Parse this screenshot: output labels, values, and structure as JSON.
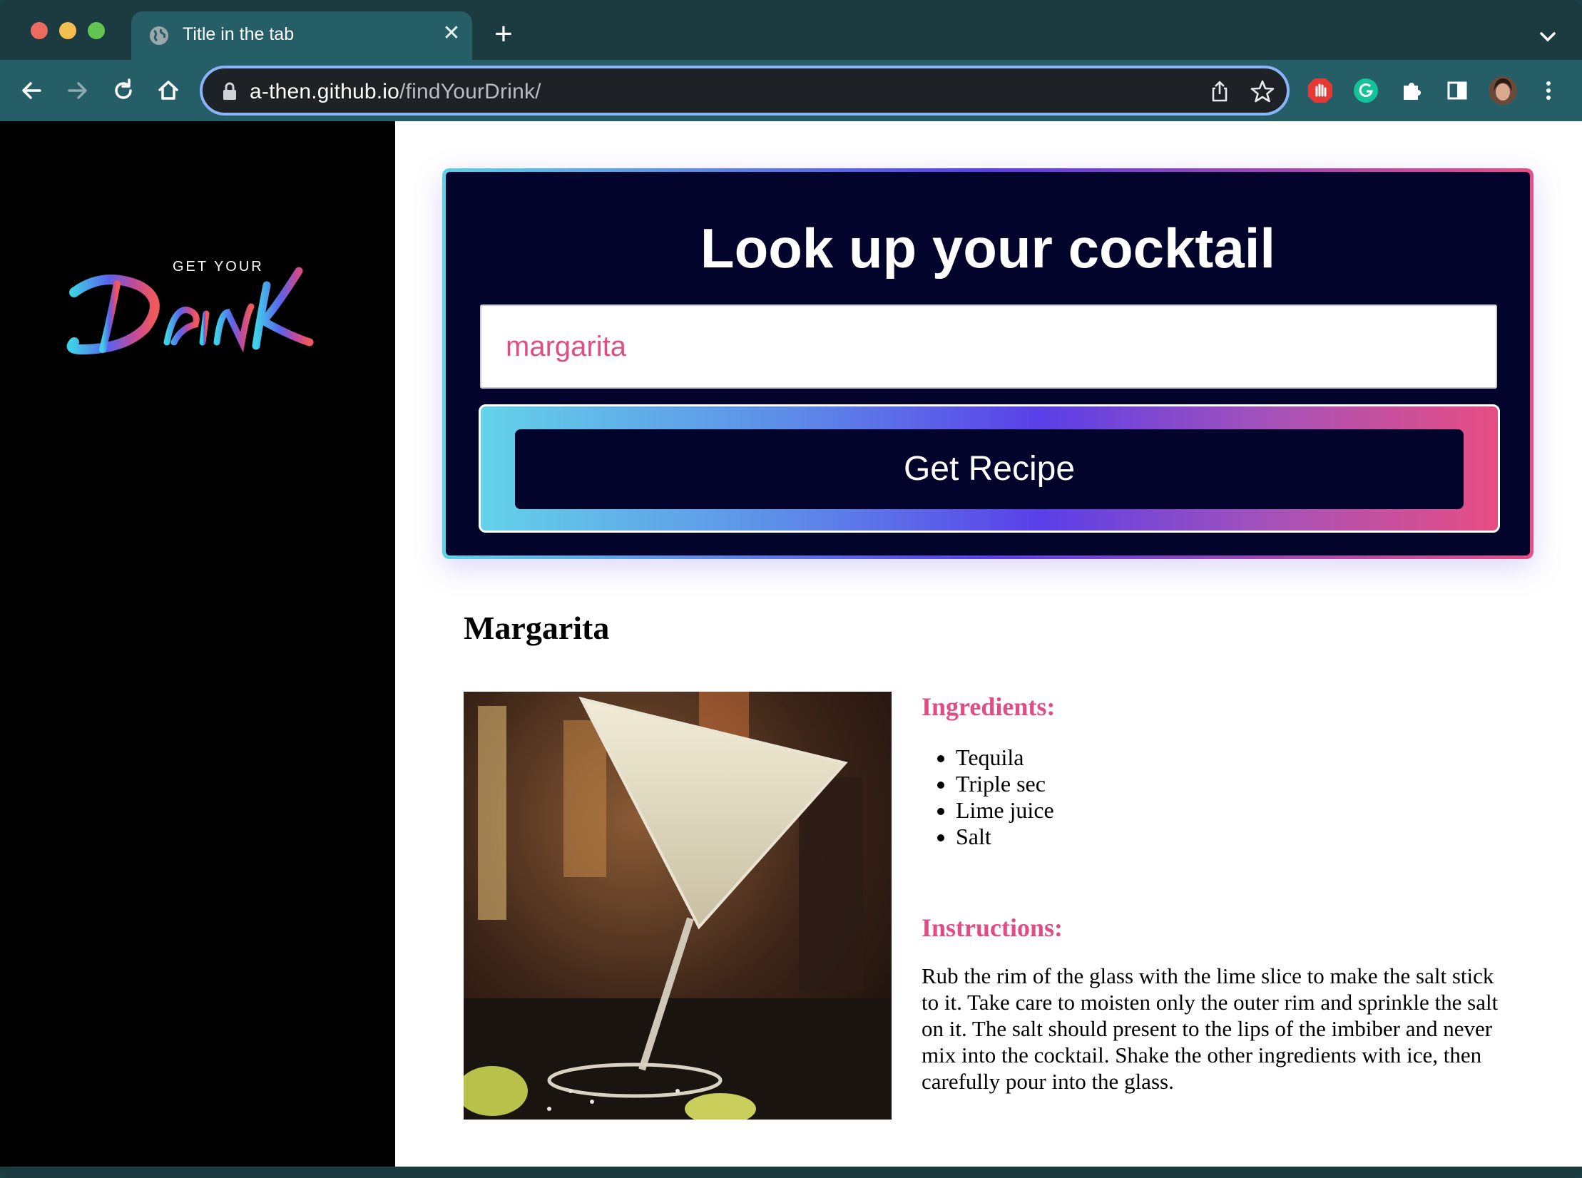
{
  "browser": {
    "tab_title": "Title in the tab",
    "url_host": "a-then.github.io",
    "url_path": "/findYourDrink/"
  },
  "sidebar": {
    "logo_top": "GET YOUR",
    "logo_main": "DRINK"
  },
  "search": {
    "title": "Look up your cocktail",
    "value": "margarita",
    "button_label": "Get Recipe"
  },
  "drink": {
    "name": "Margarita",
    "ingredients_heading": "Ingredients:",
    "ingredients": [
      "Tequila",
      "Triple sec",
      "Lime juice",
      "Salt"
    ],
    "instructions_heading": "Instructions:",
    "instructions": "Rub the rim of the glass with the lime slice to make the salt stick to it. Take care to moisten only the outer rim and sprinkle the salt on it. The salt should present to the lips of the imbiber and never mix into the cocktail. Shake the other ingredients with ice, then carefully pour into the glass."
  },
  "colors": {
    "accent_pink": "#e04d84",
    "card_dark": "#03042b",
    "gradient_cyan": "#5ed3e6",
    "gradient_violet": "#5a3fe6",
    "chrome_teal": "#265e67"
  },
  "icons": [
    "globe-icon",
    "close-icon",
    "plus-icon",
    "chevron-down-icon",
    "back-arrow-icon",
    "forward-arrow-icon",
    "reload-icon",
    "home-icon",
    "lock-icon",
    "share-icon",
    "star-icon",
    "adblock-icon",
    "grammarly-icon",
    "puzzle-icon",
    "sidepanel-icon",
    "avatar",
    "kebab-menu-icon"
  ]
}
